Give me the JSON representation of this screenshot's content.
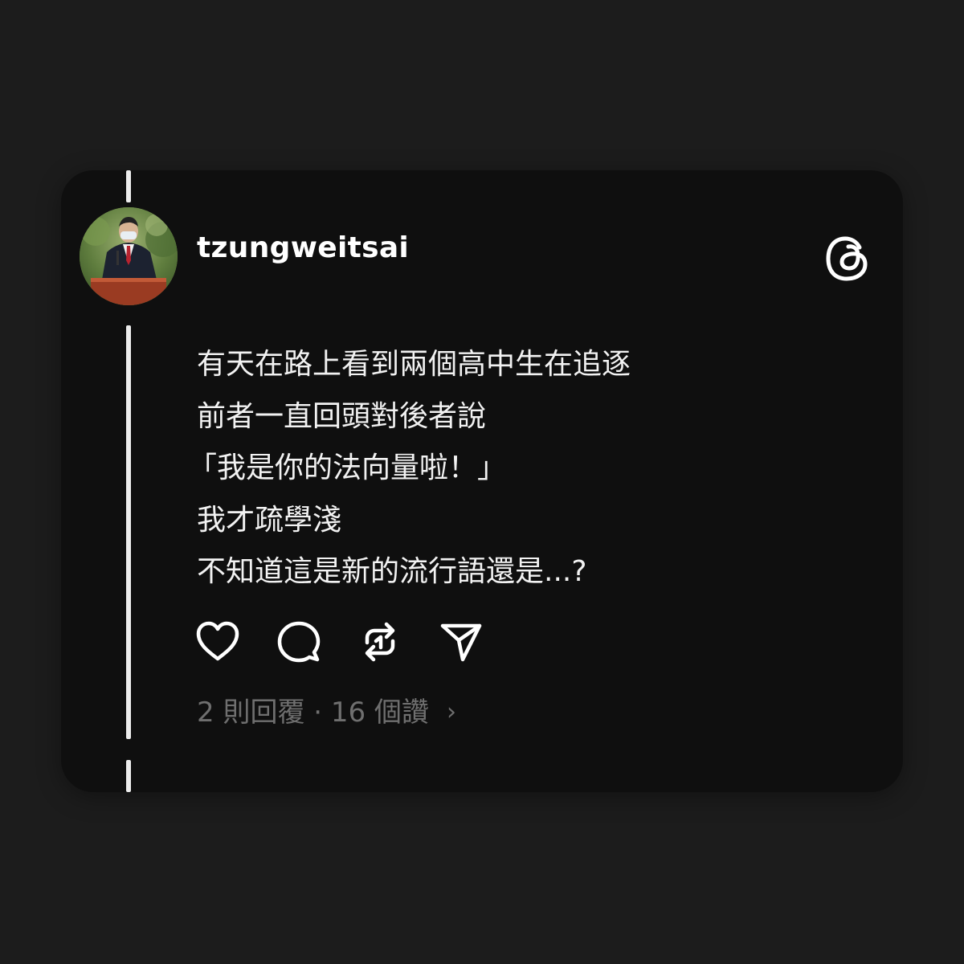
{
  "post": {
    "username": "tzungweitsai",
    "lines": [
      "有天在路上看到兩個高中生在追逐",
      "前者一直回頭對後者說",
      "「我是你的法向量啦！」",
      "我才疏學淺",
      "不知道這是新的流行語還是...?"
    ],
    "stats": {
      "text": "2 則回覆 · 16 個讚",
      "chevron": "›"
    }
  },
  "icons": {
    "brand": "threads-logo-icon",
    "actions": [
      "heart-icon",
      "comment-icon",
      "repost-icon",
      "share-icon"
    ]
  },
  "colors": {
    "page_background": "#1c1c1c",
    "card_background": "#0f0f0f",
    "text_primary": "#f2f2f2",
    "text_secondary": "#6f6f6f",
    "thread_line": "#ececec"
  }
}
